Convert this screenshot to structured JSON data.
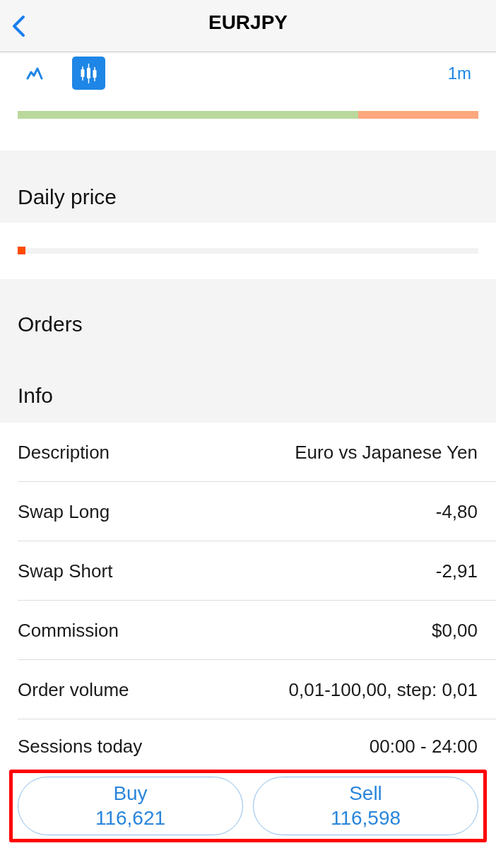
{
  "header": {
    "title": "EURJPY"
  },
  "chart_toolbar": {
    "chart_types": [
      {
        "kind": "line",
        "selected": false
      },
      {
        "kind": "candles",
        "selected": true
      }
    ],
    "timeframe": "1m",
    "sentiment": {
      "level": 0.74
    }
  },
  "daily_price": {
    "title": "Daily price",
    "level": 0
  },
  "orders": {
    "title": "Orders"
  },
  "info": {
    "title": "Info",
    "rows": [
      {
        "label": "Description",
        "value": "Euro vs Japanese Yen"
      },
      {
        "label": "Swap Long",
        "value": "-4,80"
      },
      {
        "label": "Swap Short",
        "value": "-2,91"
      },
      {
        "label": "Commission",
        "value": "$0,00"
      },
      {
        "label": "Order volume",
        "value": "0,01-100,00, step: 0,01"
      },
      {
        "label": "Sessions today",
        "value": "00:00 - 24:00"
      }
    ]
  },
  "trade_buttons": {
    "highlighted": true,
    "buttons": [
      {
        "label": "Buy",
        "price": "116,621"
      },
      {
        "label": "Sell",
        "price": "116,598"
      }
    ]
  }
}
